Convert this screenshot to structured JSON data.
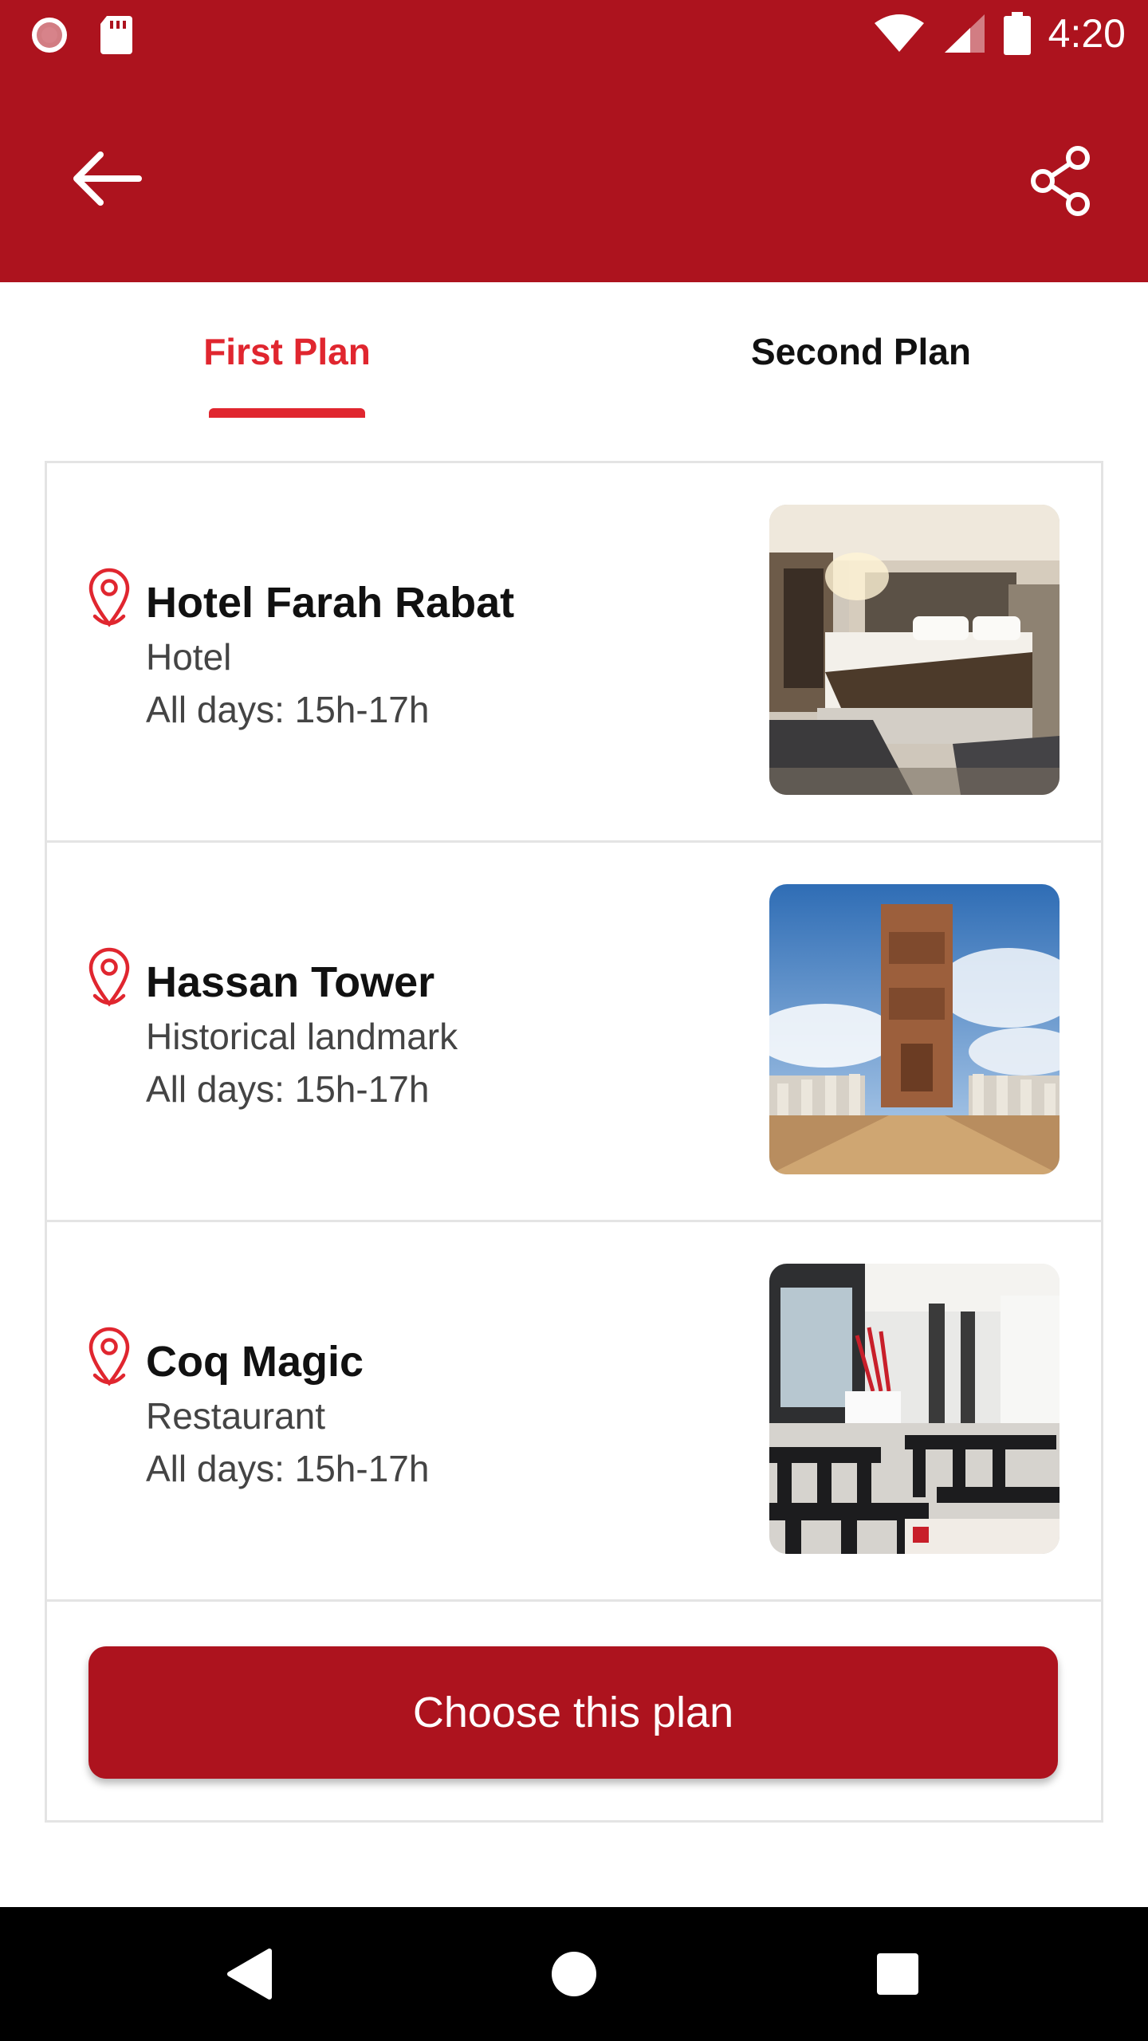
{
  "status_bar": {
    "time": "4:20",
    "icons": [
      "record-icon",
      "sd-card-icon",
      "wifi-icon",
      "signal-icon",
      "battery-icon"
    ]
  },
  "app_bar": {
    "back_icon": "arrow-left-icon",
    "share_icon": "share-icon",
    "background_color": "#ad131e"
  },
  "tabs": [
    {
      "label": "First Plan",
      "selected": true
    },
    {
      "label": "Second Plan",
      "selected": false
    }
  ],
  "plan": {
    "places": [
      {
        "name": "Hotel Farah Rabat",
        "type": "Hotel",
        "hours": "All days: 15h-17h",
        "image": "hotel-room-photo"
      },
      {
        "name": "Hassan Tower",
        "type": "Historical landmark",
        "hours": "All days: 15h-17h",
        "image": "hassan-tower-photo"
      },
      {
        "name": "Coq Magic",
        "type": "Restaurant",
        "hours": "All days: 15h-17h",
        "image": "restaurant-interior-photo"
      }
    ],
    "choose_label": "Choose this plan"
  },
  "colors": {
    "primary": "#ad131e",
    "accent": "#e0262f"
  },
  "nav_bar": {
    "icons": [
      "back-triangle-icon",
      "home-circle-icon",
      "recents-square-icon"
    ]
  }
}
